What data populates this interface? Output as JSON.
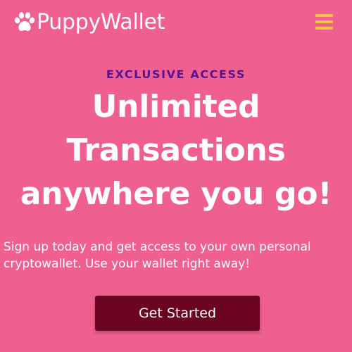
{
  "navbar": {
    "brand_name": "PuppyWallet",
    "logo_icon": "paw-icon",
    "menu_icon": "hamburger-menu-icon"
  },
  "hero": {
    "eyebrow": "EXCLUSIVE ACCESS",
    "headline_lines": [
      "Unlimited",
      "Transactions",
      "anywhere you go!"
    ],
    "description_lines": [
      "Sign up today and get access to your own personal",
      "cryptowallet. Use your wallet right away!"
    ],
    "cta_label": "Get Started"
  },
  "colors": {
    "background": "#ef6090",
    "eyebrow": "#5b1290",
    "menu_icon": "#f5c242",
    "cta_background": "#6b0420",
    "text": "#ffffff"
  }
}
